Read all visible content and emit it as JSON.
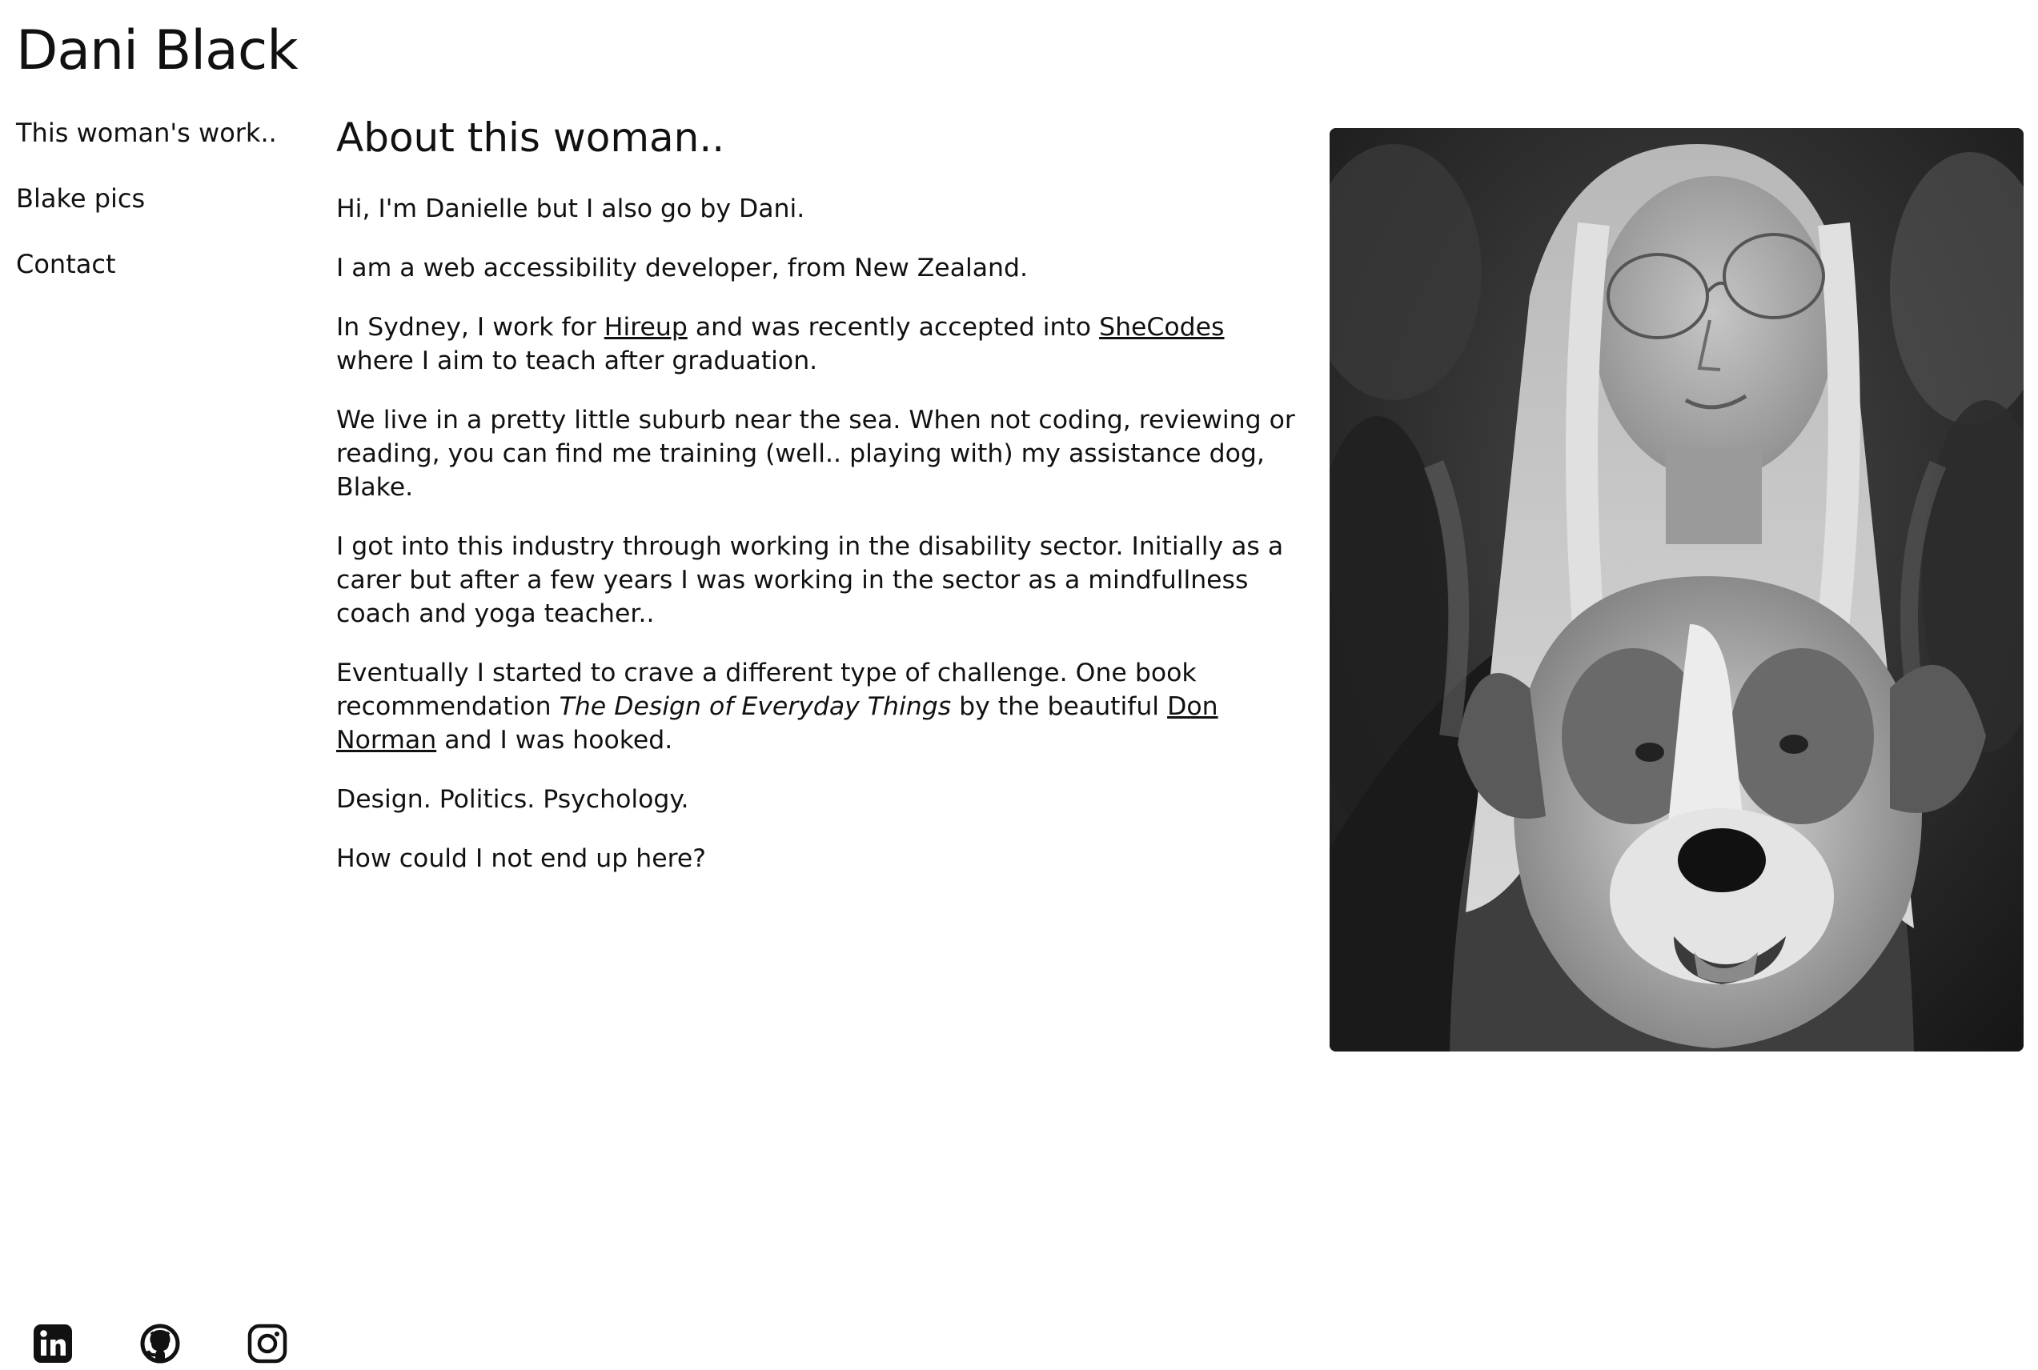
{
  "site": {
    "title": "Dani Black"
  },
  "nav": {
    "items": [
      {
        "label": "This woman's work.."
      },
      {
        "label": "Blake pics"
      },
      {
        "label": "Contact"
      }
    ]
  },
  "main": {
    "heading": "About this woman..",
    "p1": "Hi, I'm Danielle but I also go by Dani.",
    "p2": "I am a web accessibility developer, from New Zealand.",
    "p3": {
      "before": "In Sydney, I work for ",
      "link1": "Hireup",
      "middle": " and was recently accepted into ",
      "link2": "SheCodes",
      "after": " where I aim to teach after graduation."
    },
    "p4": "We live in a pretty little suburb near the sea. When not coding, reviewing or reading, you can find me training (well.. playing with) my assistance dog, Blake.",
    "p5": "I got into this industry through working in the disability sector. Initially as a carer but after a few years I was working in the sector as a mindfullness coach and yoga teacher..",
    "p6": {
      "before": "Eventually I started to crave a different type of challenge. One book recommendation ",
      "book": "The Design of Everyday Things",
      "middle": " by the beautiful ",
      "link": "Don Norman",
      "after": " and I was hooked."
    },
    "p7": "Design. Politics. Psychology.",
    "p8": "How could I not end up here?"
  },
  "photo": {
    "icon": "portrait-photo",
    "tone": "grayscale"
  },
  "social": {
    "icons": [
      "linkedin-icon",
      "github-icon",
      "instagram-icon"
    ]
  },
  "colors": {
    "text": "#111111",
    "background": "#ffffff"
  }
}
